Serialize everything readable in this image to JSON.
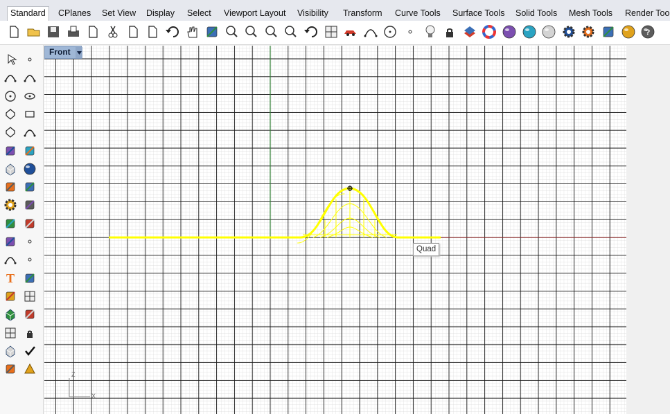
{
  "tabs": [
    {
      "label": "Standard",
      "active": true
    },
    {
      "label": "CPlanes"
    },
    {
      "label": "Set View"
    },
    {
      "label": "Display"
    },
    {
      "label": "Select"
    },
    {
      "label": "Viewport Layout"
    },
    {
      "label": "Visibility"
    },
    {
      "label": "Transform"
    },
    {
      "label": "Curve Tools"
    },
    {
      "label": "Surface Tools"
    },
    {
      "label": "Solid Tools"
    },
    {
      "label": "Mesh Tools"
    },
    {
      "label": "Render Tools"
    }
  ],
  "toolbar_icons": [
    "new-file-icon",
    "open-folder-icon",
    "save-icon",
    "print-icon",
    "import-icon",
    "cut-icon",
    "copy-icon",
    "paste-icon",
    "undo-icon",
    "pan-hand-icon",
    "rotate-view-icon",
    "zoom-icon",
    "zoom-window-icon",
    "zoom-extents-icon",
    "zoom-selected-icon",
    "undo-view-icon",
    "four-viewports-icon",
    "car-render-icon",
    "curve-tools-icon",
    "circle-icon",
    "point-edit-icon",
    "lightbulb-icon",
    "lock-icon",
    "layer-icon",
    "color-wheel-icon",
    "material-sphere-icon",
    "shaded-sphere-icon",
    "render-sphere-icon",
    "settings-icon",
    "gear-options-icon",
    "network-tools-icon",
    "globe-render-icon",
    "help-icon"
  ],
  "sidebar_icons": [
    "select-arrow-icon",
    "point-icon",
    "polyline-icon",
    "curve-control-icon",
    "circle-center-icon",
    "ellipse-icon",
    "polygon-icon",
    "rectangle-icon",
    "hexagon-icon",
    "fillet-curve-icon",
    "surface-corner-icon",
    "loft-surface-icon",
    "box-solid-icon",
    "sphere-solid-icon",
    "cylinder-solid-icon",
    "mesh-plane-icon",
    "explode-gear-icon",
    "split-icon",
    "trim-icon",
    "extend-icon",
    "boolean-union-icon",
    "points-cloud-icon",
    "arc-icon",
    "arc-points-icon",
    "text-icon",
    "dimension-icon",
    "group-icon",
    "array-icon",
    "block-icon",
    "snap-icon",
    "grid-array-icon",
    "lock-points-icon",
    "extrude-icon",
    "check-icon",
    "render-mesh-icon",
    "paint-bucket-icon"
  ],
  "viewport": {
    "title": "Front",
    "tooltip": "Quad",
    "axis_labels": {
      "z": "Z",
      "x": "X"
    },
    "colors": {
      "grid_minor": "#d9d9d9",
      "grid_major": "#1a1a1a",
      "x_axis": "#8b2a2a",
      "y_axis": "#2e7d32",
      "selection": "#ffff00"
    }
  }
}
